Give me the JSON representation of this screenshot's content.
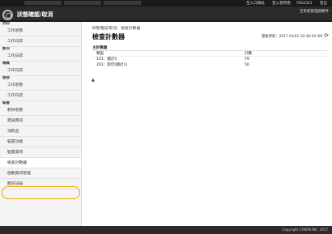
{
  "topbar": {
    "login_label": "登入使用者：",
    "user_value": "7654321",
    "logout_label": "登出",
    "device_status_label": "至入口網站"
  },
  "header": {
    "app_title": "狀態確認/取消",
    "help_link": "至系統管理員郵件"
  },
  "sidebar": {
    "groups": [
      {
        "label": "列印",
        "items": [
          "工作狀態",
          "工作日誌"
        ]
      },
      {
        "label": "影印",
        "items": [
          "工作日誌"
        ]
      },
      {
        "label": "傳真",
        "items": [
          "工作日誌"
        ]
      },
      {
        "label": "接收",
        "items": [
          "工作狀態",
          "工作日誌"
        ]
      },
      {
        "label": "裝置",
        "items": [
          "耗材狀態",
          "錯誤資訊",
          "消耗品",
          "裝置功能",
          "裝置資訊",
          "檢查計數器",
          "啟動資訊管理",
          "歷史記錄"
        ]
      }
    ]
  },
  "main": {
    "breadcrumb": "狀態確認/取消：檢查計數器",
    "title": "檢查計數器",
    "updated": "最後更新：2017 03/01 10:36:54 AM",
    "section_title": "主計數器",
    "col_type": "類型",
    "col_count": "計數",
    "rows": [
      {
        "type": "101：總計1",
        "count": "79"
      },
      {
        "type": "201：影印(總計1)",
        "count": "50"
      }
    ],
    "to_top": "▲"
  },
  "footer": {
    "copyright": "Copyright CANON INC. 2017"
  }
}
